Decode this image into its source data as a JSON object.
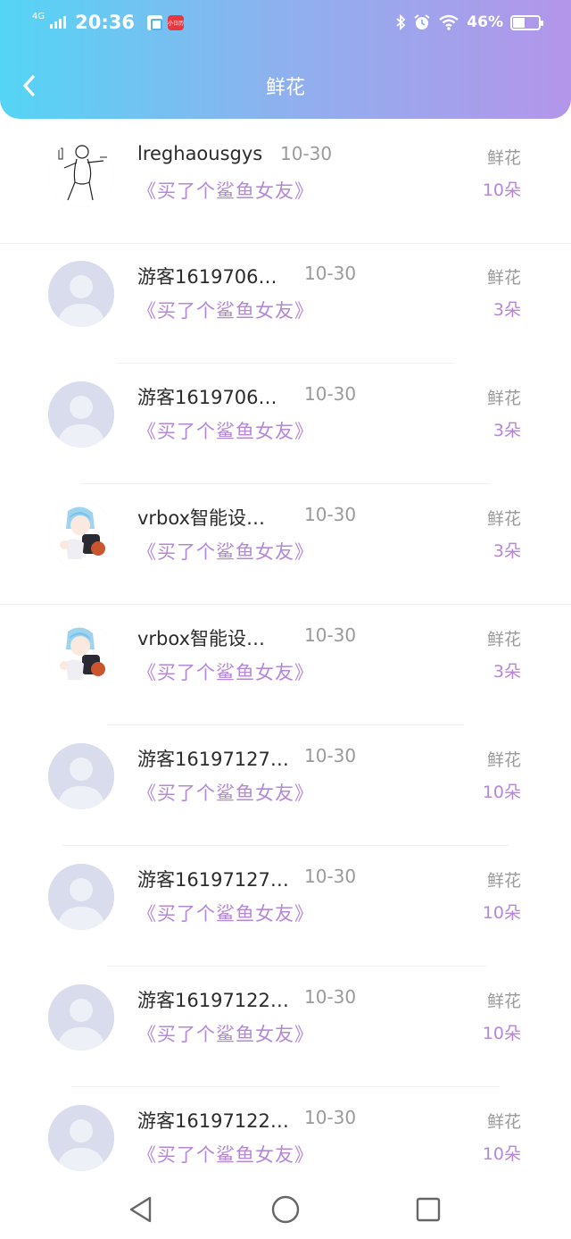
{
  "status_bar": {
    "network": "4G",
    "time": "20:36",
    "app_badge_text": "小日历",
    "battery": "46%",
    "battery_level": 0.46
  },
  "header": {
    "title": "鲜花",
    "gradient": [
      "#54d5f5",
      "#8fb0ee",
      "#b395e9"
    ]
  },
  "list": [
    {
      "name": "lreghaousgys",
      "date": "10-30",
      "book": "《买了个鲨鱼女友》",
      "gift": "鲜花",
      "count": "10朵",
      "avatar": "sketch"
    },
    {
      "name": "游客1619706…",
      "date": "10-30",
      "book": "《买了个鲨鱼女友》",
      "gift": "鲜花",
      "count": "3朵",
      "avatar": "default"
    },
    {
      "name": "游客1619706…",
      "date": "10-30",
      "book": "《买了个鲨鱼女友》",
      "gift": "鲜花",
      "count": "3朵",
      "avatar": "default"
    },
    {
      "name": "vrbox智能设…",
      "date": "10-30",
      "book": "《买了个鲨鱼女友》",
      "gift": "鲜花",
      "count": "3朵",
      "avatar": "anime"
    },
    {
      "name": "vrbox智能设…",
      "date": "10-30",
      "book": "《买了个鲨鱼女友》",
      "gift": "鲜花",
      "count": "3朵",
      "avatar": "anime"
    },
    {
      "name": "游客16197127…",
      "date": "10-30",
      "book": "《买了个鲨鱼女友》",
      "gift": "鲜花",
      "count": "10朵",
      "avatar": "default"
    },
    {
      "name": "游客16197127…",
      "date": "10-30",
      "book": "《买了个鲨鱼女友》",
      "gift": "鲜花",
      "count": "10朵",
      "avatar": "default"
    },
    {
      "name": "游客16197122…",
      "date": "10-30",
      "book": "《买了个鲨鱼女友》",
      "gift": "鲜花",
      "count": "10朵",
      "avatar": "default"
    },
    {
      "name": "游客16197122…",
      "date": "10-30",
      "book": "《买了个鲨鱼女友》",
      "gift": "鲜花",
      "count": "10朵",
      "avatar": "default"
    }
  ],
  "colors": {
    "accent": "#b487d8",
    "muted": "#9a9a9a",
    "avatar_bg": "#d8dcec",
    "avatar_fg": "#eef0f7"
  },
  "icons": {
    "back": "chevron-left-icon",
    "nav_back": "triangle-back-icon",
    "nav_home": "circle-home-icon",
    "nav_recents": "square-recents-icon"
  }
}
